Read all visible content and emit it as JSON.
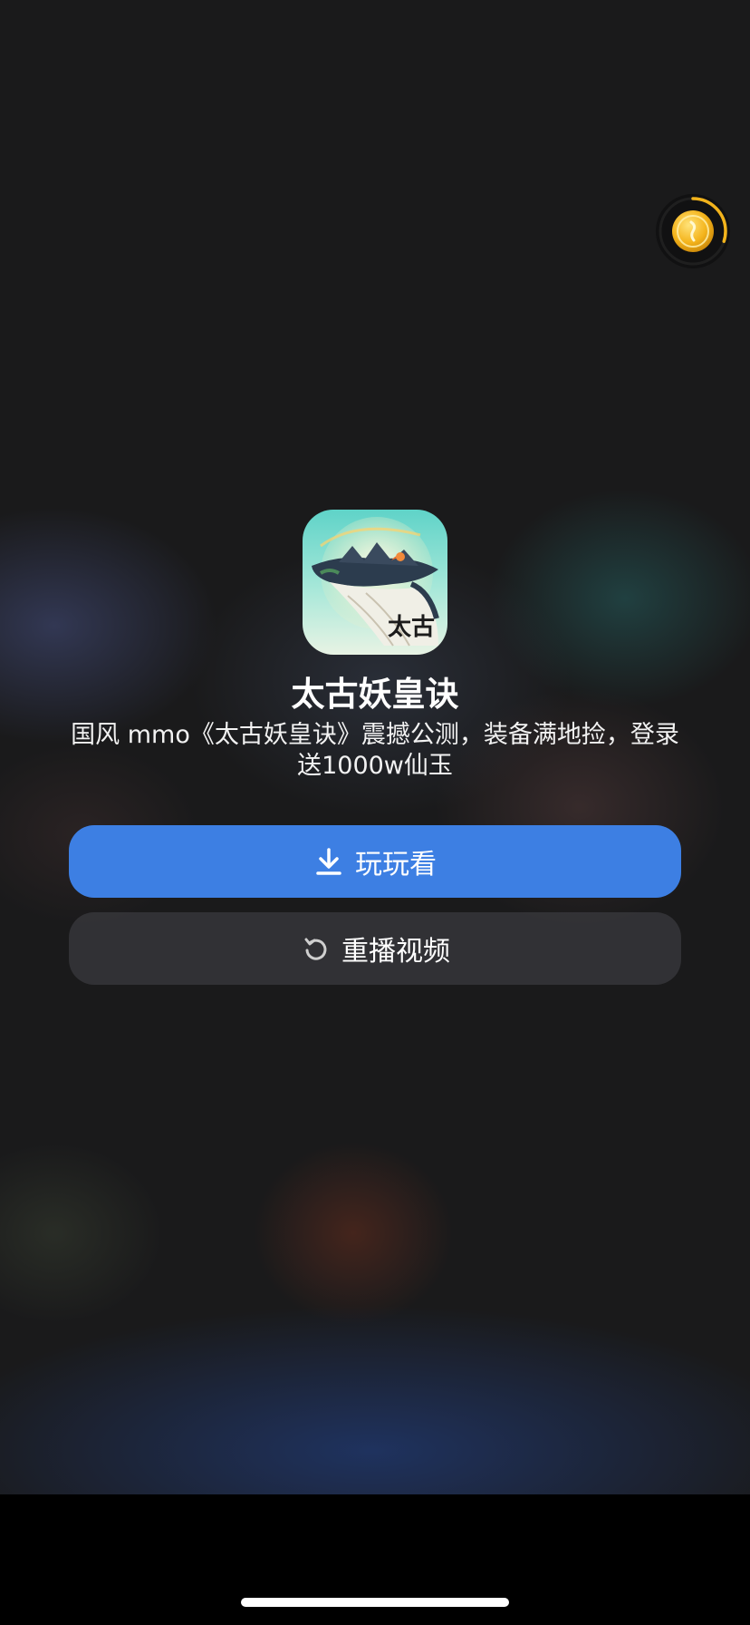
{
  "app": {
    "name": "太古妖皇诀",
    "description": "国风 mmo《太古妖皇诀》震撼公测，装备满地捡，登录送1000w仙玉",
    "icon_watermark": "太古"
  },
  "buttons": {
    "play_label": "玩玩看",
    "play_icon": "download-icon",
    "replay_label": "重播视频",
    "replay_icon": "replay-icon"
  },
  "reward": {
    "icon": "gold-coin-icon",
    "progress": 0.3
  },
  "colors": {
    "primary_button": "#3d7fe3",
    "background": "#1a1a1b",
    "coin": "#f2b31c"
  }
}
